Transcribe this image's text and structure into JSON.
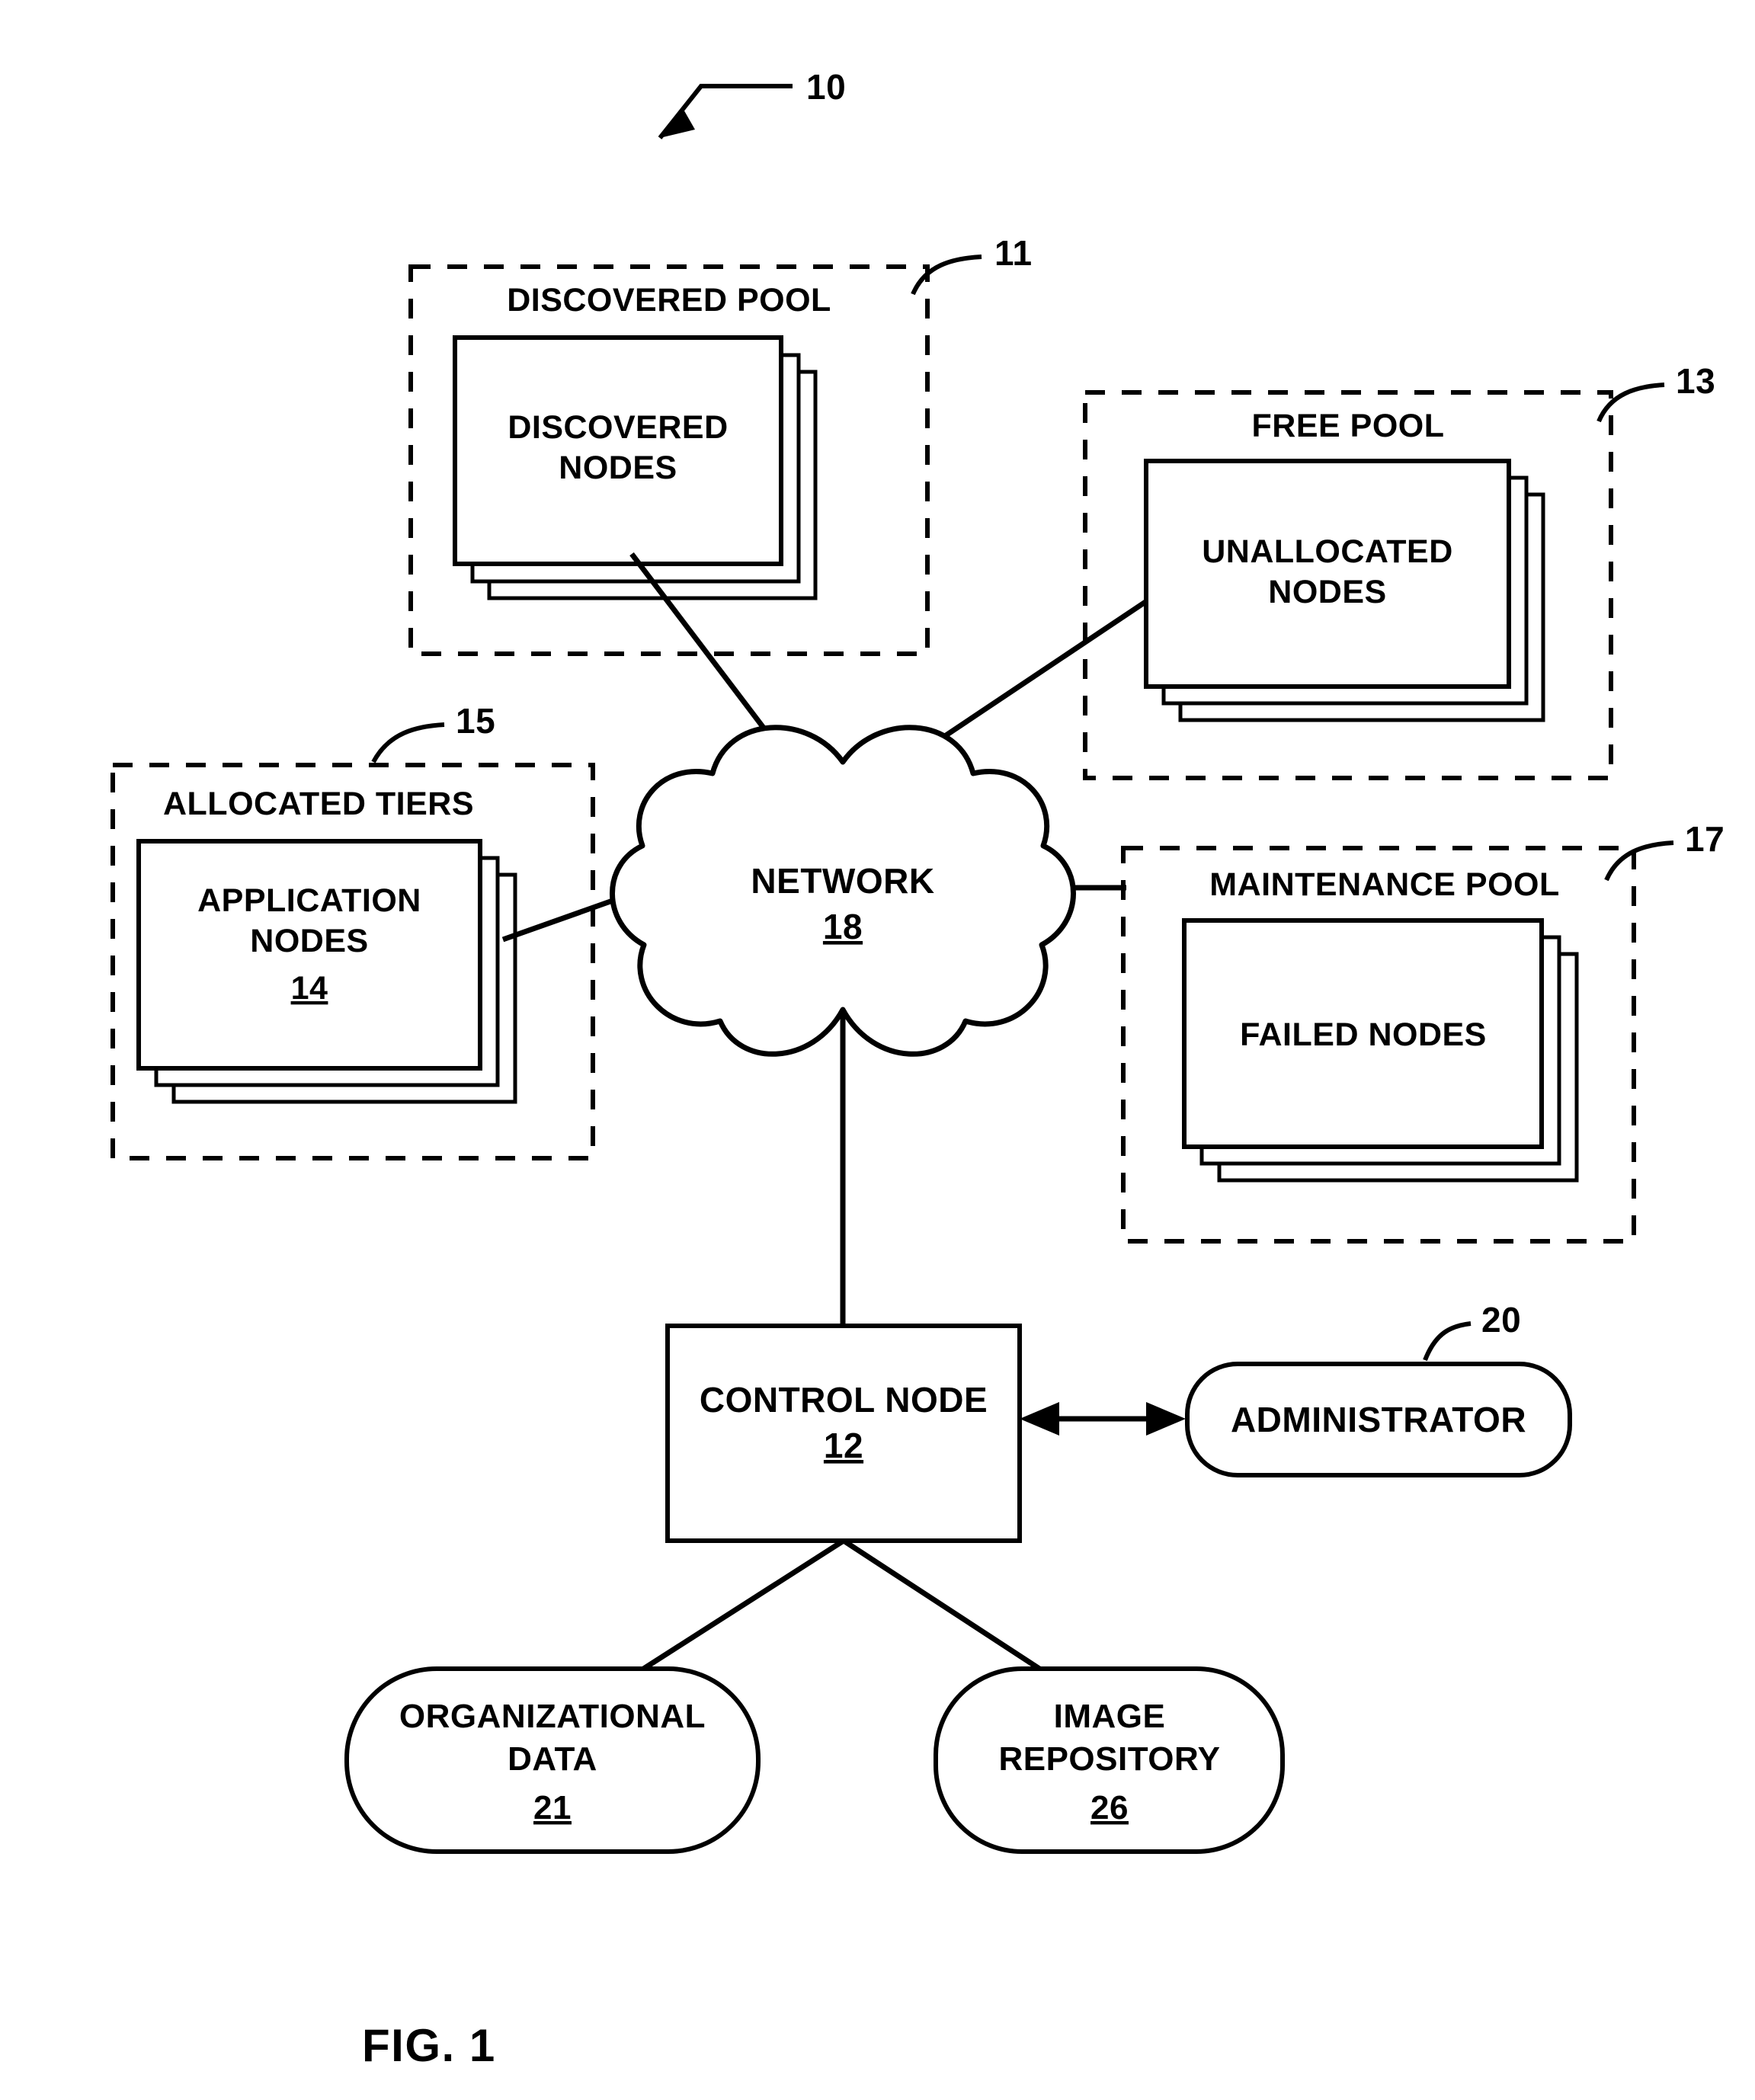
{
  "figure": {
    "caption": "FIG. 1",
    "system_ref": "10"
  },
  "pools": [
    {
      "id": "discovered-pool",
      "label": "DISCOVERED POOL",
      "ref": "11",
      "node_label_line1": "DISCOVERED",
      "node_label_line2": "NODES",
      "node_ref": ""
    },
    {
      "id": "free-pool",
      "label": "FREE POOL",
      "ref": "13",
      "node_label_line1": "UNALLOCATED",
      "node_label_line2": "NODES",
      "node_ref": ""
    },
    {
      "id": "allocated-tiers",
      "label": "ALLOCATED TIERS",
      "ref": "15",
      "node_label_line1": "APPLICATION",
      "node_label_line2": "NODES",
      "node_ref": "14"
    },
    {
      "id": "maintenance-pool",
      "label": "MAINTENANCE POOL",
      "ref": "17",
      "node_label_line1": "FAILED NODES",
      "node_label_line2": "",
      "node_ref": ""
    }
  ],
  "network": {
    "label": "NETWORK",
    "ref": "18"
  },
  "control_node": {
    "label": "CONTROL NODE",
    "ref": "12"
  },
  "administrator": {
    "label": "ADMINISTRATOR",
    "ref": "20"
  },
  "stores": [
    {
      "id": "organizational-data",
      "label_line1": "ORGANIZATIONAL",
      "label_line2": "DATA",
      "ref": "21"
    },
    {
      "id": "image-repository",
      "label_line1": "IMAGE",
      "label_line2": "REPOSITORY",
      "ref": "26"
    }
  ],
  "colors": {
    "ink": "#000000",
    "paper": "#ffffff"
  }
}
